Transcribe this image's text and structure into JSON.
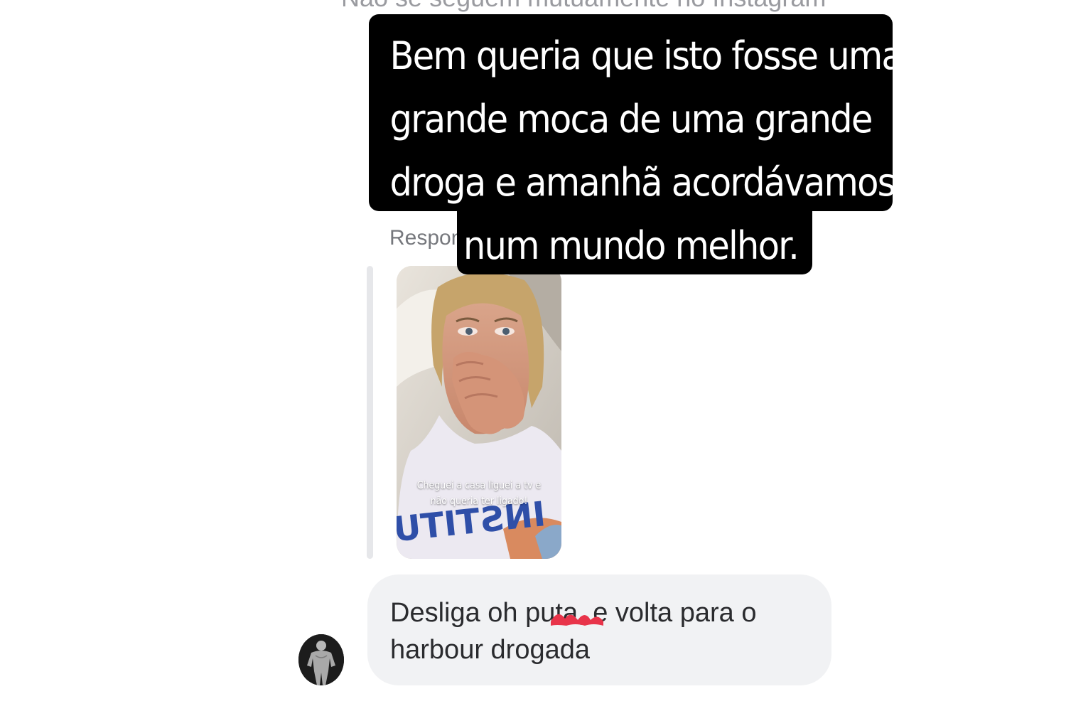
{
  "header": {
    "mutual_follow_note": "Não se seguem mutuamente no Instagram"
  },
  "story_reply": {
    "reply_label": "Respondeu à sua história",
    "story_caption": "Cheguei a casa liguei a tv e não queria ter ligado!",
    "shirt_print": "INSTITU"
  },
  "overlay_text": {
    "lines": [
      "Bem queria que isto fosse uma",
      "grande moca de uma grande",
      "droga e amanhã acordávamos",
      "num mundo melhor."
    ]
  },
  "message": {
    "line1_before": "Desliga oh p",
    "line1_censored": "uta",
    "line1_after": ", e volta para o",
    "line2": "harbour drogada"
  },
  "colors": {
    "bubble_bg": "#f1f2f4",
    "overlay_bg": "#000000",
    "censor_scribble": "#e8344a",
    "muted_text": "#76787d"
  },
  "icons": {
    "avatar": "user-avatar-image",
    "censor": "red-scribble-mark"
  }
}
